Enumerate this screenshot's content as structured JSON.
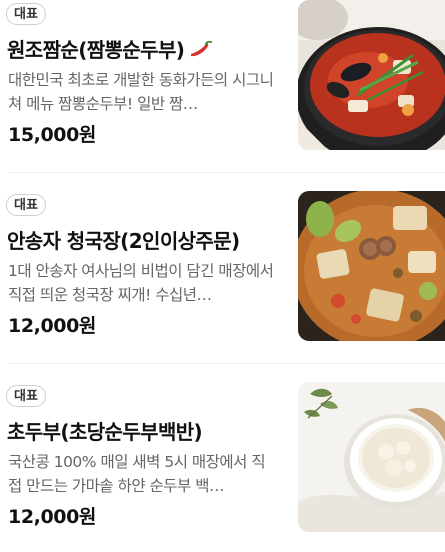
{
  "menu": {
    "items": [
      {
        "badge": "대표",
        "title": "원조짬순(짬뽕순두부)",
        "spicy_icon": "chili-pepper-icon",
        "description": "대한민국 최초로 개발한 동화가든의 시그니쳐 메뉴 짬뽕순두부! 일반 짬…",
        "price": "15,000원"
      },
      {
        "badge": "대표",
        "title": "안송자 청국장(2인이상주문)",
        "description": "1대 안송자 여사님의 비법이 담긴 매장에서 직접 띄운 청국장 찌개! 수십년…",
        "price": "12,000원"
      },
      {
        "badge": "대표",
        "title": "초두부(초당순두부백반)",
        "description": "국산콩 100% 매일 새벽 5시 매장에서 직접 만드는 가마솥 하얀 순두부 백…",
        "price": "12,000원"
      }
    ]
  },
  "colors": {
    "badge_border": "#cfcfcf",
    "description_text": "#666666",
    "divider": "#eeeeee",
    "pepper": "#d8352a"
  }
}
